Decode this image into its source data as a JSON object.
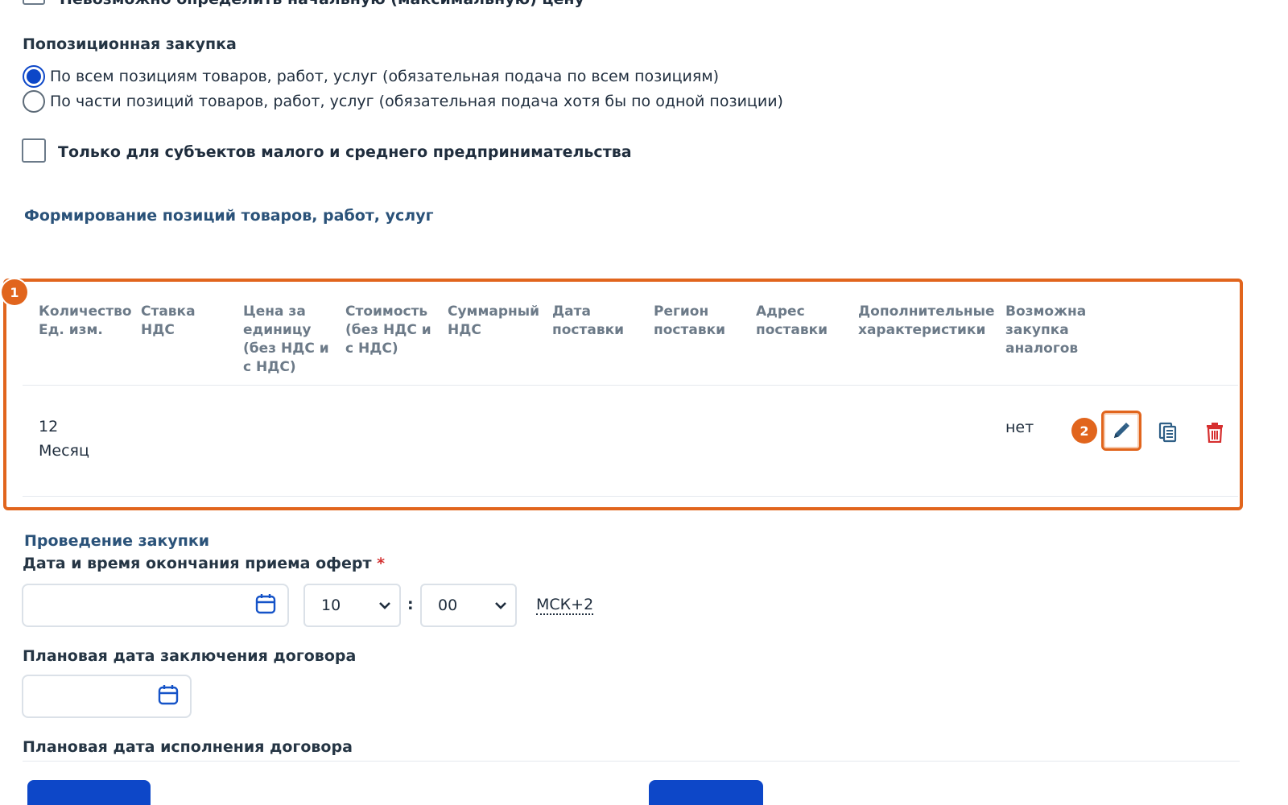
{
  "top_checkbox": {
    "label": "Невозможно определить начальную (максимальную) цену"
  },
  "purchase_type": {
    "heading": "Попозиционная закупка",
    "options": [
      {
        "label": "По всем позициям товаров, работ, услуг (обязательная подача по всем позициям)",
        "checked": true
      },
      {
        "label": "По части позиций товаров, работ, услуг (обязательная подача хотя бы по одной позиции)",
        "checked": false
      }
    ]
  },
  "sme_checkbox": {
    "label": "Только для субъектов малого и среднего предпринимательства",
    "checked": false
  },
  "positions": {
    "heading": "Формирование позиций товаров, работ, услуг",
    "badge": "1",
    "columns": [
      [
        "Количество",
        "Ед. изм."
      ],
      [
        "Ставка",
        "НДС"
      ],
      [
        "Цена за",
        "единицу",
        "(без НДС и",
        "с НДС)"
      ],
      [
        "Стоимость",
        "(без НДС и",
        "с НДС)"
      ],
      [
        "Суммарный",
        "НДС"
      ],
      [
        "Дата",
        "поставки"
      ],
      [
        "Регион",
        "поставки"
      ],
      [
        "Адрес",
        "поставки"
      ],
      [
        "Дополнительные",
        "характеристики"
      ],
      [
        "Возможна",
        "закупка",
        "аналогов"
      ]
    ],
    "rows": [
      {
        "quantity": "12",
        "unit": "Месяц",
        "analogs": "нет"
      }
    ],
    "action_badge": "2",
    "icons": {
      "edit": "pencil-icon",
      "copy": "copy-icon",
      "delete": "trash-icon"
    },
    "accent_color": "#e1651d"
  },
  "procurement": {
    "heading": "Проведение закупки",
    "deadline_label": "Дата и время окончания приема оферт",
    "required_mark": "*",
    "hour": "10",
    "separator": ":",
    "minute": "00",
    "timezone": "МСК+2",
    "contract_date_label": "Плановая дата заключения договора",
    "execution_date_label": "Плановая дата исполнения договора"
  }
}
